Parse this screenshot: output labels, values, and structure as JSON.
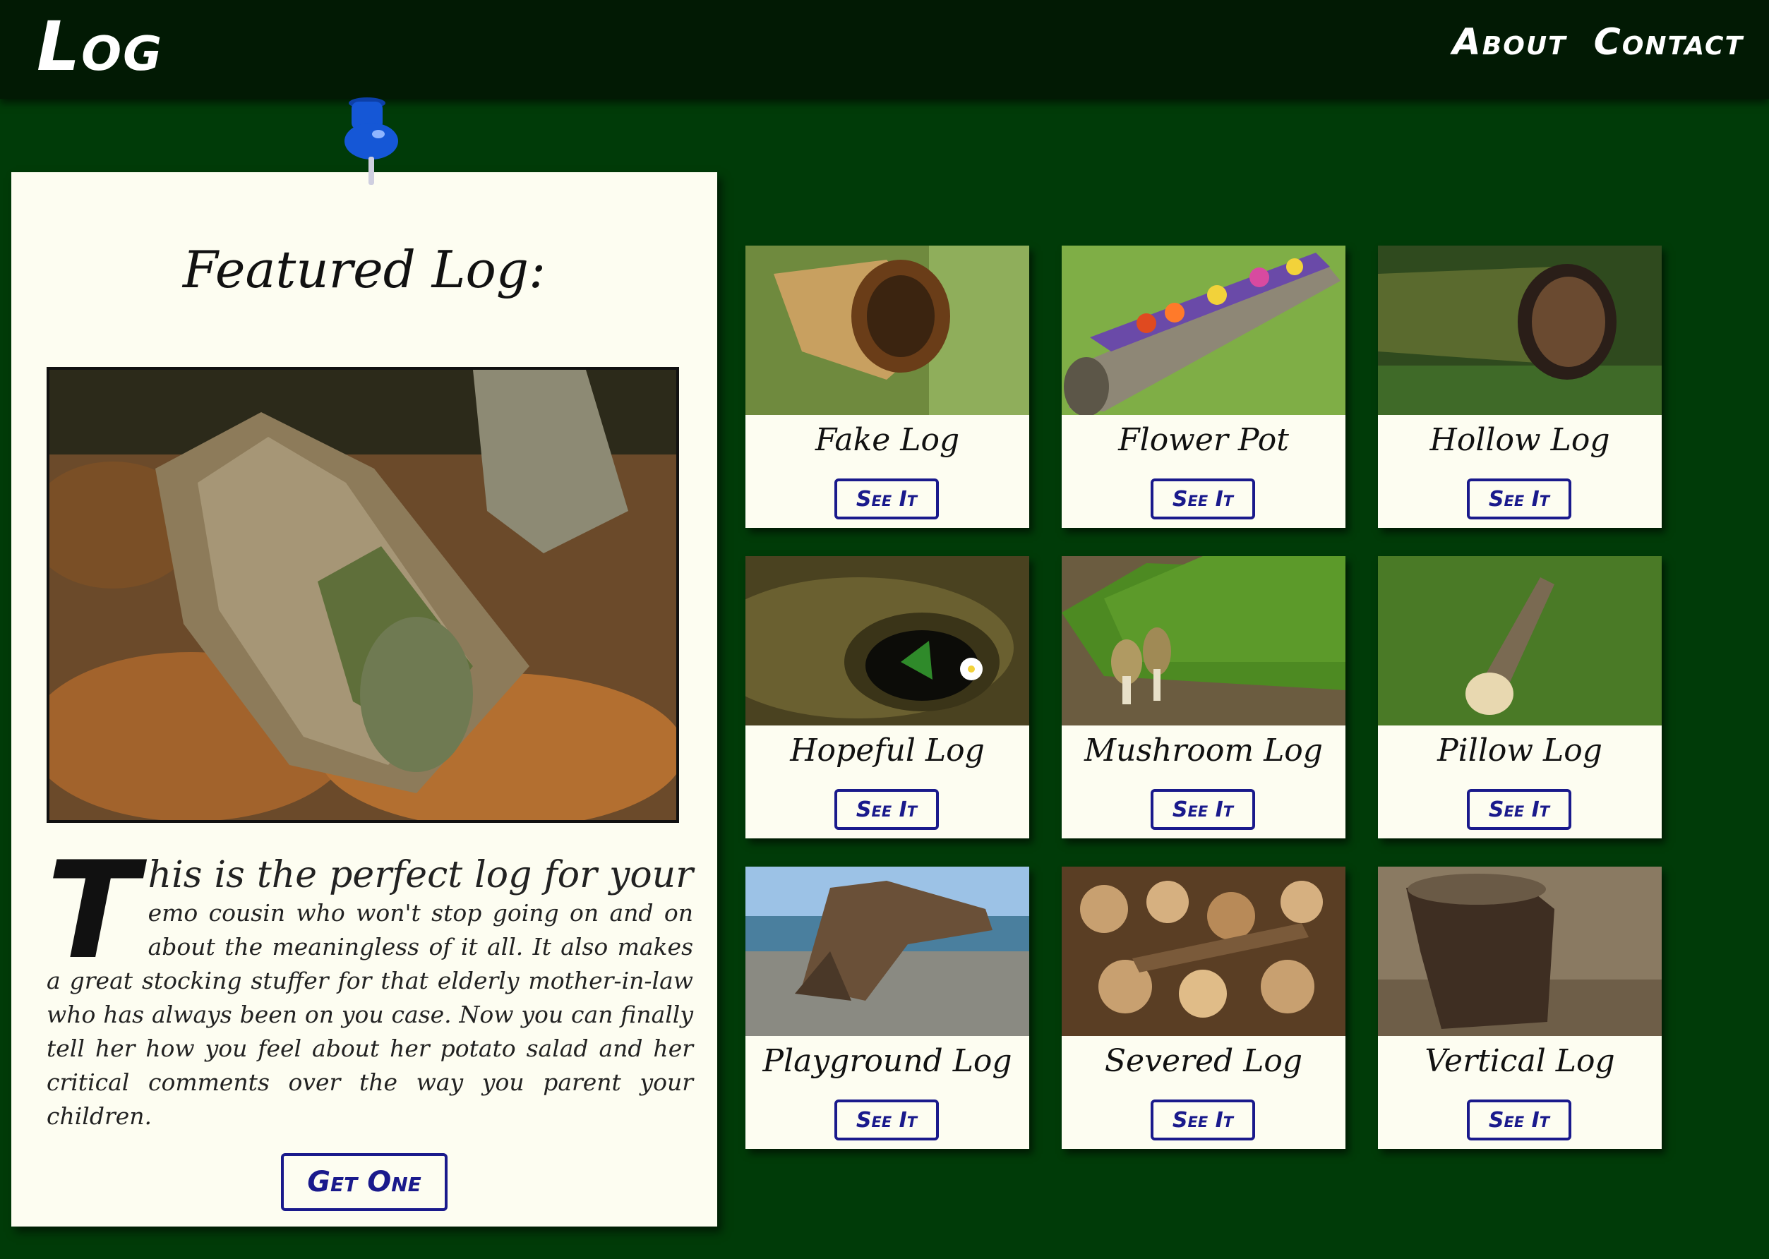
{
  "header": {
    "logo": "Log",
    "nav": [
      "About",
      "Contact"
    ]
  },
  "featured": {
    "title": "Featured Log:",
    "drop_cap": "T",
    "lead": "his is the perfect log for your",
    "body": "emo cousin who won't stop going on and on about the meaningless of it all. It also makes a great stocking stuffer for that elderly mother-in-law who has always been on you case. Now you can finally tell her how you feel about her potato salad and her critical comments over the way you parent your children.",
    "button": "Get One"
  },
  "cards": [
    {
      "name": "Fake Log",
      "button": "See It"
    },
    {
      "name": "Flower Pot",
      "button": "See It"
    },
    {
      "name": "Hollow Log",
      "button": "See It"
    },
    {
      "name": "Hopeful Log",
      "button": "See It"
    },
    {
      "name": "Mushroom Log",
      "button": "See It"
    },
    {
      "name": "Pillow Log",
      "button": "See It"
    },
    {
      "name": "Playground Log",
      "button": "See It"
    },
    {
      "name": "Severed Log",
      "button": "See It"
    },
    {
      "name": "Vertical Log",
      "button": "See It"
    }
  ],
  "colors": {
    "background": "#003b08",
    "header": "#021a04",
    "card": "#fdfdf1",
    "button_border": "#1a1a8c",
    "pin": "#1557d6"
  }
}
